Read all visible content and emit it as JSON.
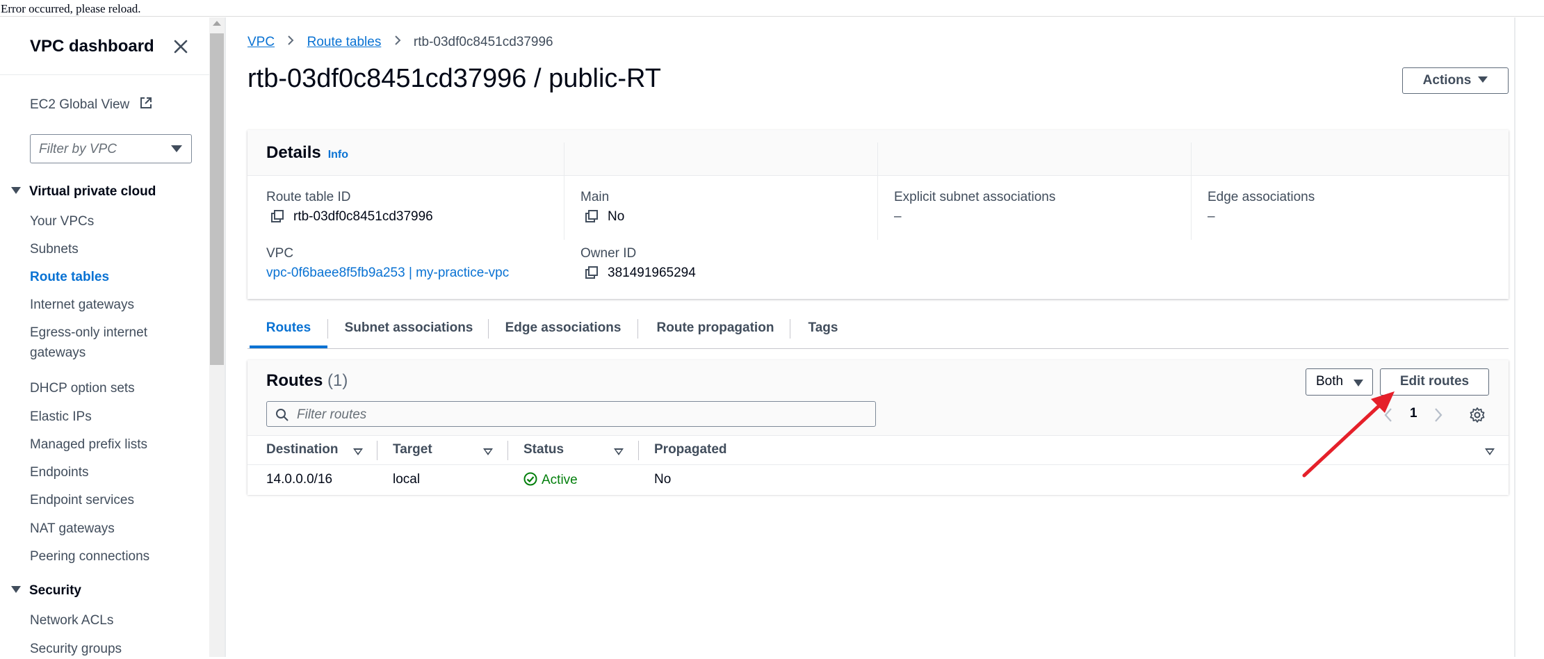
{
  "error_banner": "Error occurred, please reload.",
  "sidebar": {
    "title": "VPC dashboard",
    "ec2_global_view": "EC2 Global View",
    "filter_placeholder": "Filter by VPC",
    "section_vpc": "Virtual private cloud",
    "vpc_items": [
      "Your VPCs",
      "Subnets",
      "Route tables",
      "Internet gateways",
      "Egress-only internet",
      "gateways",
      "DHCP option sets",
      "Elastic IPs",
      "Managed prefix lists",
      "Endpoints",
      "Endpoint services",
      "NAT gateways",
      "Peering connections"
    ],
    "active_item": "Route tables",
    "section_security": "Security",
    "security_items": [
      "Network ACLs",
      "Security groups"
    ]
  },
  "breadcrumb": {
    "root": "VPC",
    "parent": "Route tables",
    "current": "rtb-03df0c8451cd37996"
  },
  "page_title": "rtb-03df0c8451cd37996 / public-RT",
  "actions_label": "Actions",
  "details": {
    "heading": "Details",
    "info": "Info",
    "route_table_id_label": "Route table ID",
    "route_table_id": "rtb-03df0c8451cd37996",
    "vpc_label": "VPC",
    "vpc_value": "vpc-0f6baee8f5fb9a253 | my-practice-vpc",
    "main_label": "Main",
    "main_value": "No",
    "owner_label": "Owner ID",
    "owner_value": "381491965294",
    "explicit_label": "Explicit subnet associations",
    "explicit_value": "–",
    "edge_label": "Edge associations",
    "edge_value": "–"
  },
  "tabs": [
    "Routes",
    "Subnet associations",
    "Edge associations",
    "Route propagation",
    "Tags"
  ],
  "routes": {
    "heading": "Routes",
    "count": "(1)",
    "filter_select": "Both",
    "edit_label": "Edit routes",
    "search_placeholder": "Filter routes",
    "page": "1",
    "columns": [
      "Destination",
      "Target",
      "Status",
      "Propagated"
    ],
    "rows": [
      {
        "destination": "14.0.0.0/16",
        "target": "local",
        "status": "Active",
        "propagated": "No"
      }
    ]
  },
  "colors": {
    "link": "#0972d3",
    "success": "#037f0c",
    "arrow": "#e5202a"
  }
}
